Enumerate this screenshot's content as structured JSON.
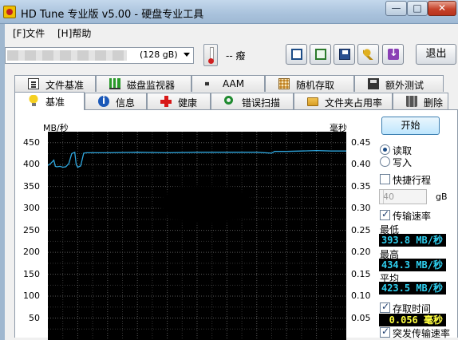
{
  "window": {
    "title": "HD Tune 专业版 v5.00 - 硬盘专业工具",
    "min_glyph": "—",
    "max_glyph": "□",
    "close_glyph": "✕"
  },
  "menu": {
    "file": "[F]文件",
    "help": "[H]帮助"
  },
  "toolbar": {
    "drive_size": "(128 gB)",
    "temperature": "-- 癈",
    "exit_label": "退出",
    "icons": [
      "copy-icon",
      "copy-green-icon",
      "save-icon",
      "options-icon",
      "download-icon"
    ]
  },
  "tabs_row1": [
    "文件基准",
    "磁盘监视器",
    "AAM",
    "随机存取",
    "额外测试"
  ],
  "tabs_row2": [
    "基准",
    "信息",
    "健康",
    "错误扫描",
    "文件夹占用率",
    "删除"
  ],
  "active_tab": "基准",
  "controls": {
    "start_label": "开始",
    "read_label": "读取",
    "write_label": "写入",
    "quick_label": "快捷行程",
    "quick_value": "40",
    "quick_unit": "gB",
    "transfer_label": "传输速率",
    "min_label": "最低",
    "min_value": "393.8 MB/秒",
    "max_label": "最高",
    "max_value": "434.3 MB/秒",
    "avg_label": "平均",
    "avg_value": "423.5 MB/秒",
    "access_label": "存取时间",
    "access_value": "0.056 毫秒",
    "burst_label": "突发传输速率",
    "mode_selected": "read",
    "quick_checked": false,
    "transfer_checked": true,
    "access_checked": true,
    "burst_checked": true
  },
  "chart_data": {
    "type": "line",
    "y_left_unit": "MB/秒",
    "y_right_unit": "毫秒",
    "y_left_ticks": [
      "450",
      "400",
      "350",
      "300",
      "250",
      "200",
      "150",
      "100",
      "50"
    ],
    "y_right_ticks": [
      "0.45",
      "0.40",
      "0.35",
      "0.30",
      "0.25",
      "0.20",
      "0.15",
      "0.10",
      "0.05"
    ],
    "ylim_left": [
      0,
      475
    ],
    "ylim_right": [
      0,
      0.475
    ],
    "xlim": [
      0,
      100
    ],
    "grid": true,
    "series": [
      {
        "color": "#2fa8e0",
        "x": [
          0,
          1,
          2,
          2.5,
          3,
          4,
          5,
          6,
          7,
          8,
          9,
          9.5,
          10,
          11,
          12,
          13,
          20,
          30,
          40,
          50,
          60,
          70,
          75,
          76,
          80,
          85,
          90,
          95,
          100
        ],
        "y": [
          398,
          403,
          410,
          396,
          395,
          396,
          394,
          395,
          402,
          425,
          428,
          400,
          394,
          397,
          426,
          427,
          427,
          428,
          427,
          428,
          428,
          428,
          426,
          430,
          430,
          431,
          432,
          431,
          431
        ]
      }
    ]
  }
}
